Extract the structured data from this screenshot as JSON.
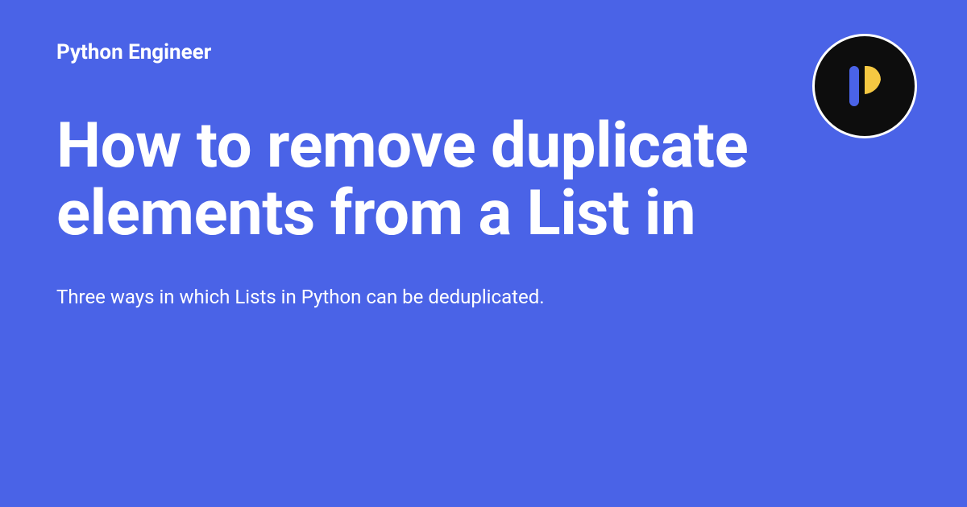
{
  "site_name": "Python Engineer",
  "title": "How to remove duplicate elements from a List in",
  "subtitle": "Three ways in which Lists in Python can be deduplicated."
}
